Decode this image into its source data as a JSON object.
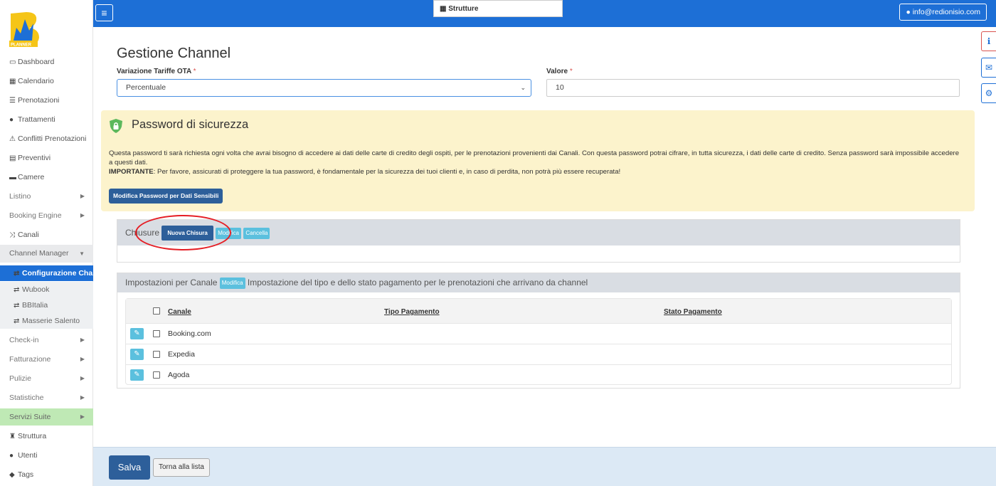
{
  "brand": {
    "logo_text": "PLANNER"
  },
  "sidebar": {
    "items": [
      {
        "label": "Dashboard",
        "icon": "desktop-icon"
      },
      {
        "label": "Calendario",
        "icon": "calendar-icon"
      },
      {
        "label": "Prenotazioni",
        "icon": "list-icon"
      },
      {
        "label": "Trattamenti",
        "icon": "apple-icon"
      },
      {
        "label": "Conflitti Prenotazioni",
        "icon": "warning-icon"
      },
      {
        "label": "Preventivi",
        "icon": "calculator-icon"
      },
      {
        "label": "Camere",
        "icon": "bed-icon"
      },
      {
        "label": "Listino"
      },
      {
        "label": "Booking Engine"
      },
      {
        "label": "Canali",
        "icon": "random-icon"
      },
      {
        "label": "Channel Manager"
      },
      {
        "label": "Configurazione Cha..."
      },
      {
        "label": "Wubook"
      },
      {
        "label": "BBItalia"
      },
      {
        "label": "Masserie Salento"
      },
      {
        "label": "Check-in"
      },
      {
        "label": "Fatturazione"
      },
      {
        "label": "Pulizie"
      },
      {
        "label": "Statistiche"
      },
      {
        "label": "Servizi Suite"
      },
      {
        "label": "Struttura",
        "icon": "building-icon"
      },
      {
        "label": "Utenti",
        "icon": "user-icon"
      },
      {
        "label": "Tags",
        "icon": "tags-icon"
      }
    ]
  },
  "topbar": {
    "structure_label": "Strutture",
    "user_email": "info@redionisio.com"
  },
  "page": {
    "title": "Gestione Channel",
    "variazione_label": "Variazione Tariffe OTA",
    "variazione_value": "Percentuale",
    "valore_label": "Valore",
    "valore_value": "10",
    "required_mark": "*"
  },
  "security": {
    "title": "Password di sicurezza",
    "text": "Questa password ti sarà richiesta ogni volta che avrai bisogno di accedere ai dati delle carte di credito degli ospiti, per le prenotazioni provenienti dai Canali. Con questa password potrai cifrare, in tutta sicurezza, i dati delle carte di credito. Senza password sarà impossibile accedere a questi dati.",
    "important_label": "IMPORTANTE",
    "important_text": ": Per favore, assicurati di proteggere la tua password, è fondamentale per la sicurezza dei tuoi clienti e, in caso di perdita, non potrà più essere recuperata!",
    "button": "Modifica Password per Dati Sensibili"
  },
  "chiusure": {
    "title": "Chiusure",
    "btn_new": "Nuova Chisura",
    "btn_edit": "Modifica",
    "btn_delete": "Cancella"
  },
  "impostazioni": {
    "title": "Impostazioni per Canale",
    "btn_edit": "Modifica",
    "description": "Impostazione del tipo e dello stato pagamento per le prenotazioni che arrivano da channel",
    "columns": [
      "Canale",
      "Tipo Pagamento",
      "Stato Pagamento"
    ],
    "rows": [
      "Booking.com",
      "Expedia",
      "Agoda"
    ]
  },
  "footer": {
    "save": "Salva",
    "back": "Torna alla lista"
  },
  "colors": {
    "primary": "#1d6fd6",
    "warning_bg": "#fcf3cc",
    "highlight_circle": "#e51d24",
    "info_btn": "#5bc0de"
  }
}
